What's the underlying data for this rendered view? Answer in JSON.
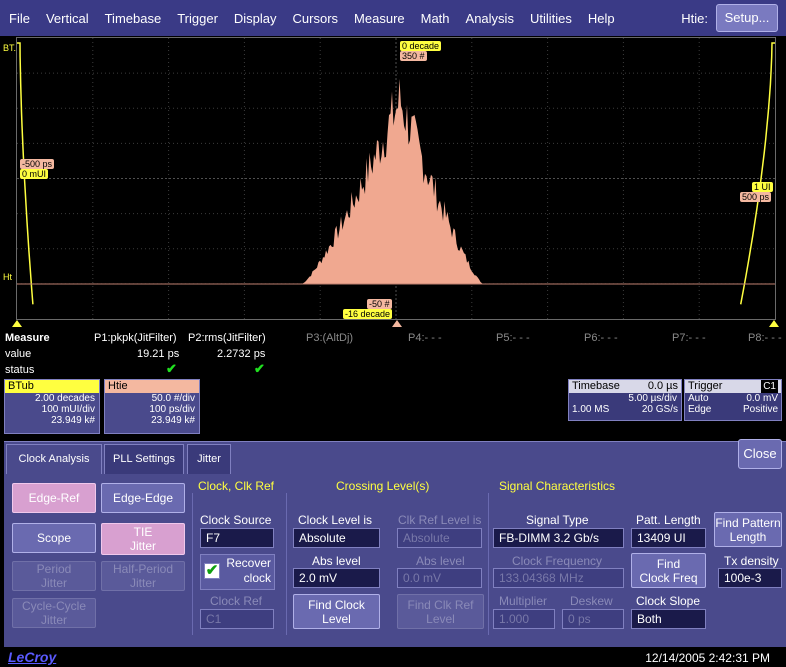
{
  "menu": {
    "items": [
      "File",
      "Vertical",
      "Timebase",
      "Trigger",
      "Display",
      "Cursors",
      "Measure",
      "Math",
      "Analysis",
      "Utilities",
      "Help"
    ],
    "right_label": "Htie:",
    "setup_label": "Setup..."
  },
  "grid": {
    "left_top_label": "BT.",
    "left_bottom_label": "Ht",
    "top_tag_1": "0 decade",
    "top_tag_2": "350 #",
    "left_tag_1": "-500 ps",
    "left_tag_2": "0 mUI",
    "right_tag_1": "1 UI",
    "right_tag_2": "500 ps",
    "bottom_tag_1": "-50 #",
    "bottom_tag_2": "-16 decade",
    "histogram_color": "#f0a890",
    "bathtub_color": "#ffff40"
  },
  "measure": {
    "label_title": "Measure",
    "label_value": "value",
    "label_status": "status",
    "params": [
      {
        "name": "P1:pkpk(JitFilter)",
        "value": "19.21 ps",
        "status": "✔"
      },
      {
        "name": "P2:rms(JitFilter)",
        "value": "2.2732 ps",
        "status": "✔"
      },
      {
        "name": "P3:(AltDj)",
        "value": "",
        "status": ""
      },
      {
        "name": "P4:- - -",
        "value": "",
        "status": ""
      },
      {
        "name": "P5:- - -",
        "value": "",
        "status": ""
      },
      {
        "name": "P6:- - -",
        "value": "",
        "status": ""
      },
      {
        "name": "P7:- - -",
        "value": "",
        "status": ""
      },
      {
        "name": "P8:- - -",
        "value": "",
        "status": ""
      }
    ]
  },
  "descriptors": {
    "btub": {
      "name": "BTub",
      "line1": "2.00 decades",
      "line2": "100 mUI/div",
      "line3": "23.949 k#",
      "color": "#ffff40"
    },
    "htie": {
      "name": "Htie",
      "line1": "50.0 #/div",
      "line2": "100 ps/div",
      "line3": "23.949 k#",
      "color": "#f4b8a0"
    },
    "timebase": {
      "name": "Timebase",
      "value": "0.0 µs",
      "row2_right": "5.00 µs/div",
      "row3_left": "1.00 MS",
      "row3_right": "20 GS/s"
    },
    "trigger": {
      "name": "Trigger",
      "badge": "C1",
      "row2_left": "Auto",
      "row2_right": "0.0 mV",
      "row3_left": "Edge",
      "row3_right": "Positive"
    }
  },
  "tabs": [
    "Clock Analysis",
    "PLL Settings",
    "Jitter"
  ],
  "close_label": "Close",
  "panel": {
    "left_buttons": {
      "edge_ref": "Edge-Ref",
      "edge_edge": "Edge-Edge",
      "scope": "Scope",
      "tie_jitter": "TIE\nJitter",
      "period_jitter": "Period\nJitter",
      "half_period_jitter": "Half-Period\nJitter",
      "cycle_cycle_jitter": "Cycle-Cycle\nJitter"
    },
    "clock_section": {
      "title": "Clock, Clk Ref",
      "clock_source_label": "Clock Source",
      "clock_source_value": "F7",
      "recover_clock_label": "Recover\nclock",
      "recover_clock_checked": true,
      "clock_ref_label": "Clock Ref",
      "clock_ref_value": "C1"
    },
    "crossing_section": {
      "title": "Crossing Level(s)",
      "clock_level_label": "Clock Level is",
      "clock_level_value": "Absolute",
      "clk_ref_level_label": "Clk Ref Level is",
      "clk_ref_level_value": "Absolute",
      "abs_level_label": "Abs level",
      "abs_level_value": "2.0 mV",
      "abs_level2_label": "Abs level",
      "abs_level2_value": "0.0 mV",
      "find_clock_level": "Find Clock\nLevel",
      "find_clk_ref_level": "Find Clk Ref\nLevel"
    },
    "signal_section": {
      "title": "Signal Characteristics",
      "signal_type_label": "Signal Type",
      "signal_type_value": "FB-DIMM 3.2 Gb/s",
      "patt_length_label": "Patt. Length",
      "patt_length_value": "13409 UI",
      "find_pattern_length": "Find Pattern\nLength",
      "clock_frequency_label": "Clock Frequency",
      "clock_frequency_value": "133.04368 MHz",
      "find_clock_freq": "Find\nClock Freq",
      "tx_density_label": "Tx  density",
      "tx_density_value": "100e-3",
      "multiplier_label": "Multiplier",
      "multiplier_value": "1.000",
      "deskew_label": "Deskew",
      "deskew_value": "0 ps",
      "clock_slope_label": "Clock Slope",
      "clock_slope_value": "Both"
    }
  },
  "status": {
    "logo": "LeCroy",
    "datetime": "12/14/2005 2:42:31 PM"
  }
}
